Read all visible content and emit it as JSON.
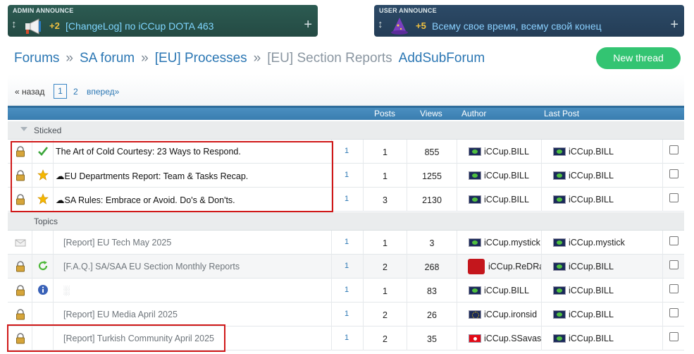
{
  "admin_announce": {
    "title": "ADMIN ANNOUNCE",
    "count": "+2",
    "text": "[ChangeLog] по iCCup DOTA 463",
    "icon": "megaphone-icon"
  },
  "user_announce": {
    "title": "USER ANNOUNCE",
    "count": "+5",
    "text": "Всему свое время, всему свой конец",
    "icon": "wizard-hat-icon"
  },
  "breadcrumb": {
    "items": [
      "Forums",
      "SA forum",
      "[EU] Processes"
    ],
    "separator": "»",
    "current": "[EU] Section Reports",
    "add_sub": "AddSubForum"
  },
  "new_thread_label": "New thread",
  "pagination": {
    "prev": "« назад",
    "current": "1",
    "page2": "2",
    "next": "вперед»"
  },
  "table_header": {
    "posts": "Posts",
    "views": "Views",
    "author": "Author",
    "last_post": "Last Post"
  },
  "sections": {
    "sticked": "Sticked",
    "topics": "Topics"
  },
  "sticked_rows": [
    {
      "status": "check-icon",
      "prefix": "",
      "title": "The Art of Cold Courtesy: 23 Ways to Respond.",
      "pages": "1",
      "posts": "1",
      "views": "855",
      "author": "iCCup.BILL",
      "last_post": "iCCup.BILL"
    },
    {
      "status": "star-icon",
      "prefix": "☁",
      "title": "EU Departments Report: Team & Tasks Recap.",
      "pages": "1",
      "posts": "1",
      "views": "1255",
      "author": "iCCup.BILL",
      "last_post": "iCCup.BILL"
    },
    {
      "status": "star-icon",
      "prefix": "☁",
      "title": "SA Rules: Embrace or Avoid. Do's & Don'ts.",
      "pages": "1",
      "posts": "3",
      "views": "2130",
      "author": "iCCup.BILL",
      "last_post": "iCCup.BILL"
    }
  ],
  "topic_rows": [
    {
      "title": "[Report] EU Tech May 2025",
      "pages": "1",
      "posts": "1",
      "views": "3",
      "author": "iCCup.mystick",
      "last_post": "iCCup.mystick"
    },
    {
      "title": "[F.A.Q.] SA/SAA EU Section Monthly Reports",
      "pages": "1",
      "posts": "2",
      "views": "268",
      "author": "iCCup.ReDRa",
      "last_post": "iCCup.BILL"
    },
    {
      "title": "░",
      "pages": "1",
      "posts": "1",
      "views": "83",
      "author": "iCCup.BILL",
      "last_post": "iCCup.BILL"
    },
    {
      "title": "[Report] EU Media April 2025",
      "pages": "1",
      "posts": "2",
      "views": "26",
      "author": "iCCup.ironsid",
      "last_post": "iCCup.BILL"
    },
    {
      "title": "[Report] Turkish Community April 2025",
      "pages": "1",
      "posts": "2",
      "views": "35",
      "author": "iCCup.SSavas",
      "last_post": "iCCup.BILL"
    }
  ]
}
